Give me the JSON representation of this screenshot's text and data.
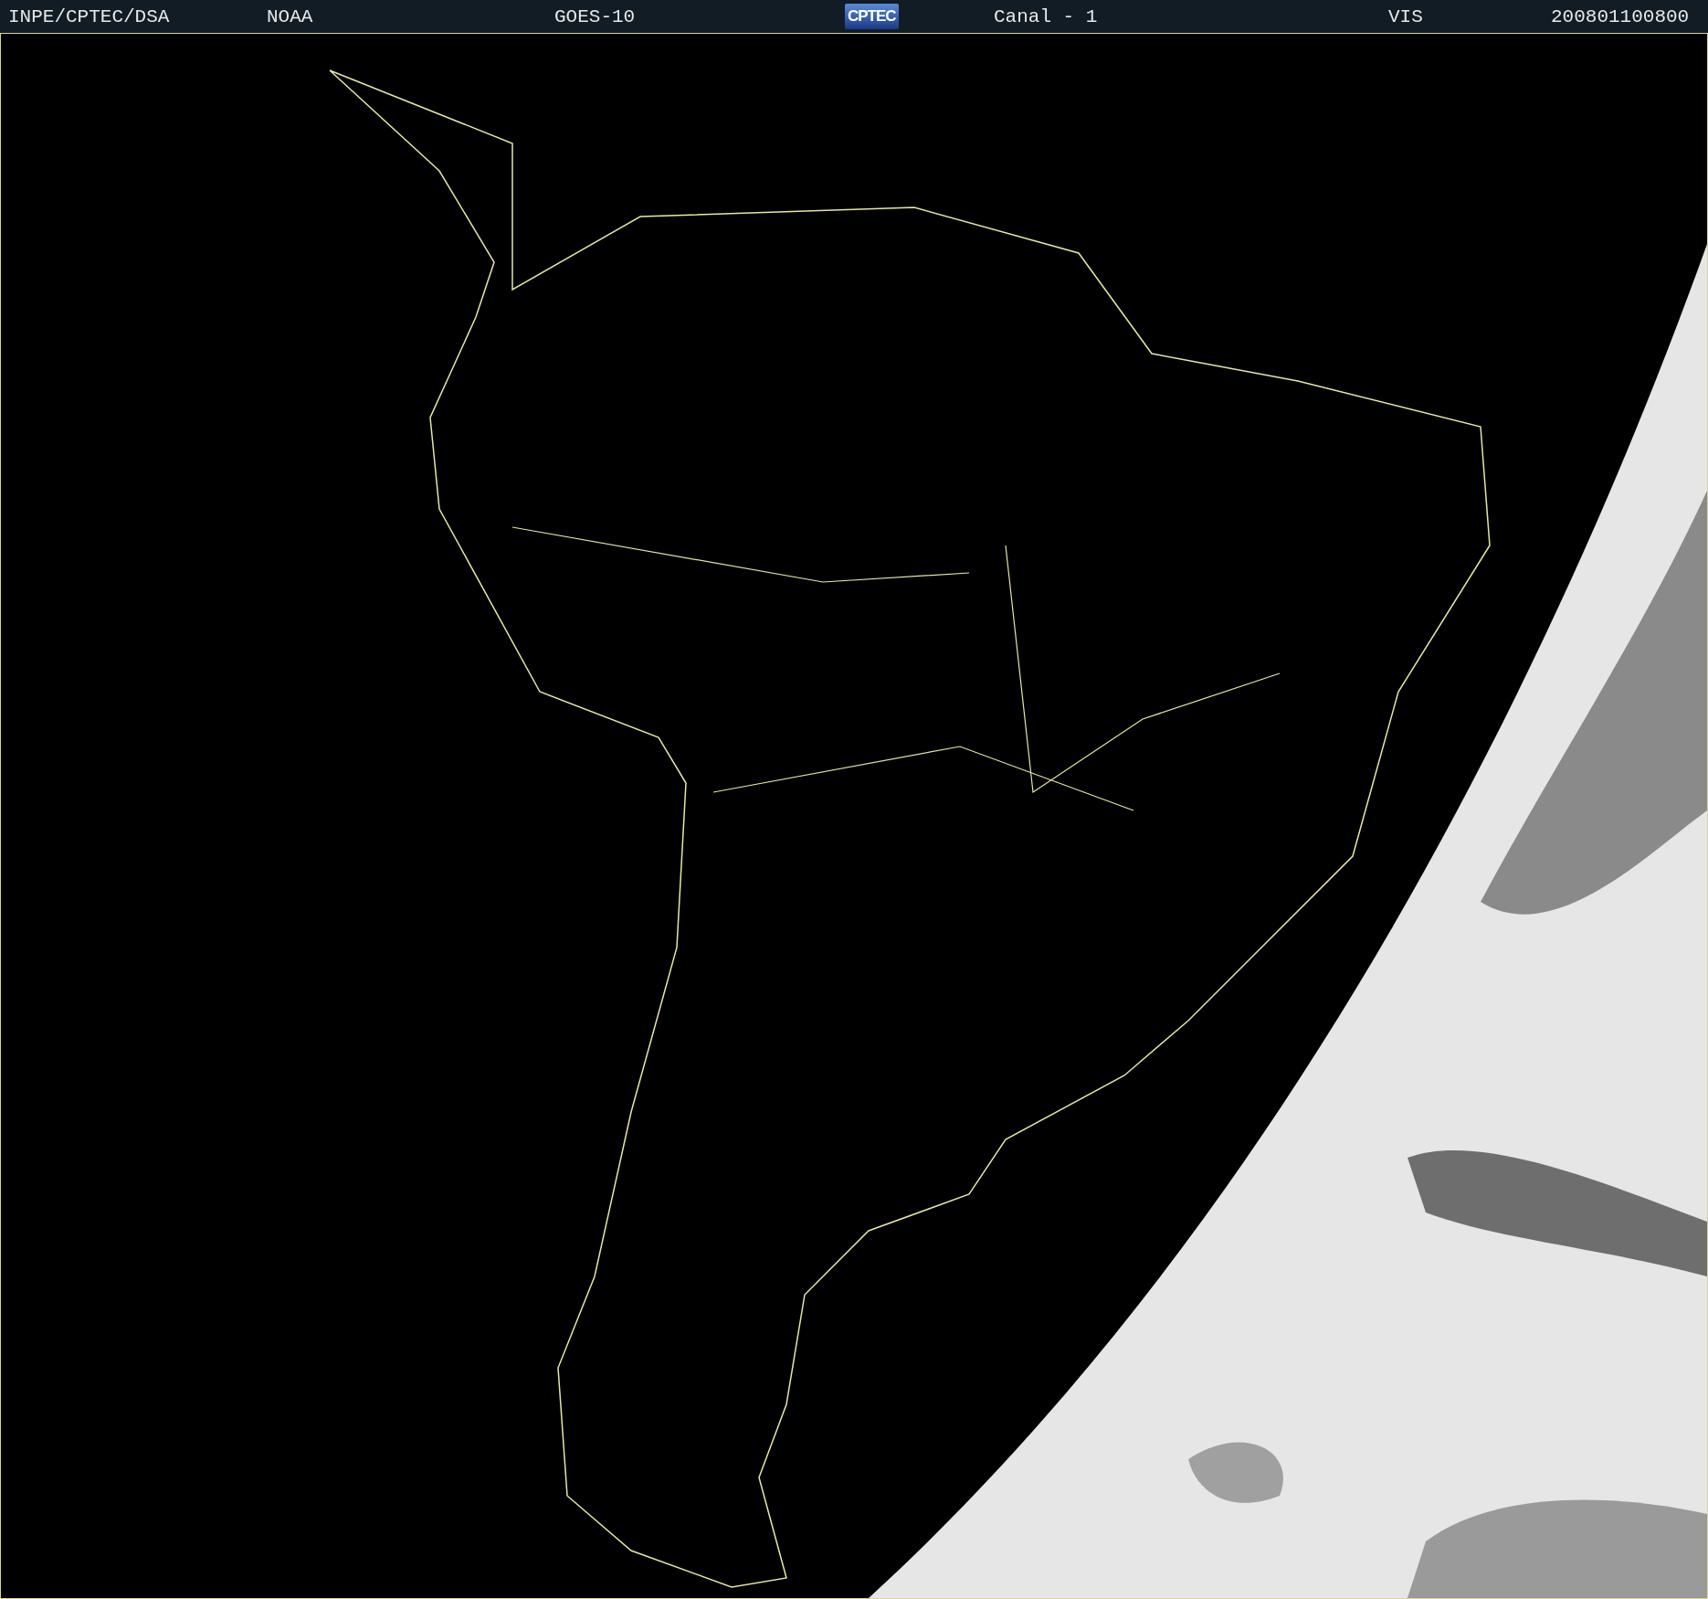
{
  "header": {
    "items": [
      {
        "kind": "text",
        "text": "INPE/CPTEC/DSA"
      },
      {
        "kind": "text",
        "text": "NOAA"
      },
      {
        "kind": "text",
        "text": "GOES-10"
      },
      {
        "kind": "logo",
        "text": "CPTEC"
      },
      {
        "kind": "text",
        "text": "Canal - 1"
      },
      {
        "kind": "text",
        "text": "VIS"
      },
      {
        "kind": "text",
        "text": "200801100800"
      }
    ]
  }
}
